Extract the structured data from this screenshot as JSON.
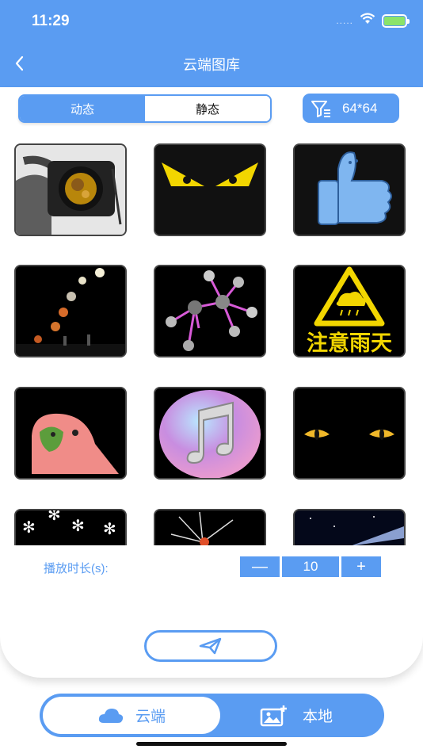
{
  "status": {
    "time": "11:29",
    "signal": "....."
  },
  "header": {
    "title": "云端图库"
  },
  "tabs": {
    "dynamic": "动态",
    "static": "静态"
  },
  "size": {
    "label": "64*64"
  },
  "duration": {
    "label": "播放时长(s):",
    "value": "10",
    "minus": "—",
    "plus": "+"
  },
  "bottom_nav": {
    "cloud": "云端",
    "local": "本地"
  },
  "thumbnails": [
    {
      "name": "camera-hand",
      "caption": ""
    },
    {
      "name": "angry-eyes",
      "caption": ""
    },
    {
      "name": "thumbs-up",
      "caption": ""
    },
    {
      "name": "bouncing-balls",
      "caption": ""
    },
    {
      "name": "molecule",
      "caption": ""
    },
    {
      "name": "rain-warning",
      "caption": "注意雨天"
    },
    {
      "name": "parrot",
      "caption": ""
    },
    {
      "name": "music-note",
      "caption": ""
    },
    {
      "name": "cat-eyes",
      "caption": ""
    },
    {
      "name": "snowflakes",
      "caption": ""
    },
    {
      "name": "fireworks",
      "caption": ""
    },
    {
      "name": "space-comet",
      "caption": ""
    }
  ],
  "colors": {
    "accent": "#5a9cf2",
    "battery": "#8be36a"
  }
}
